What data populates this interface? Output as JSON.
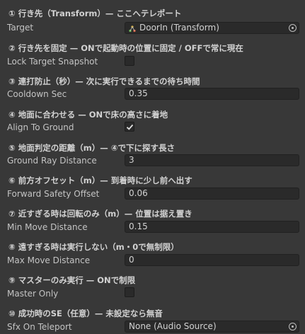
{
  "sections": [
    {
      "header": "① 行き先（Transform）— ここへテレポート",
      "label": "Target",
      "kind": "object",
      "value": "DoorIn (Transform)",
      "icon": "transform-icon"
    },
    {
      "header": "② 行き先を固定 — ONで起動時の位置に固定 / OFFで常に現在",
      "label": "Lock Target Snapshot",
      "kind": "checkbox",
      "checked": false
    },
    {
      "header": "③ 連打防止（秒）— 次に実行できるまでの待ち時間",
      "label": "Cooldown Sec",
      "kind": "number",
      "value": "0.35"
    },
    {
      "header": "④ 地面に合わせる — ONで床の高さに着地",
      "label": "Align To Ground",
      "kind": "checkbox",
      "checked": true
    },
    {
      "header": "⑤ 地面判定の距離（m）— ④で下に探す長さ",
      "label": "Ground Ray Distance",
      "kind": "number",
      "value": "3"
    },
    {
      "header": "⑥ 前方オフセット（m）— 到着時に少し前へ出す",
      "label": "Forward Safety Offset",
      "kind": "number",
      "value": "0.06"
    },
    {
      "header": "⑦ 近すぎる時は回転のみ（m）— 位置は据え置き",
      "label": "Min Move Distance",
      "kind": "number",
      "value": "0.15"
    },
    {
      "header": "⑧ 遠すぎる時は実行しない（m・0で無制限）",
      "label": "Max Move Distance",
      "kind": "number",
      "value": "0"
    },
    {
      "header": "⑨ マスターのみ実行 — ONで制限",
      "label": "Master Only",
      "kind": "checkbox",
      "checked": false
    },
    {
      "header": "⑩ 成功時のSE（任意）— 未設定なら無音",
      "label": "Sfx On Teleport",
      "kind": "object",
      "value": "None (Audio Source)",
      "icon": ""
    }
  ],
  "colors": {
    "background": "#383838",
    "field": "#2a2a2a",
    "text": "#c4c4c4",
    "header_text": "#d2d2d2"
  }
}
